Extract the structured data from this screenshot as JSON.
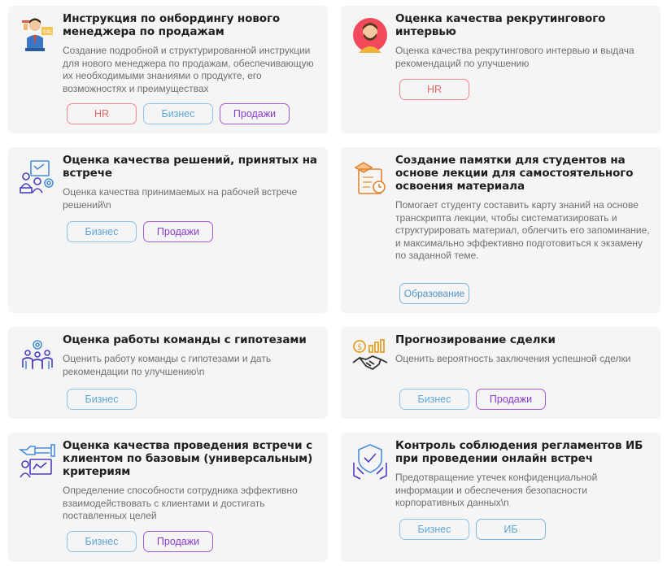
{
  "cards": [
    {
      "icon": "sales-manager-icon",
      "title": "Инструкция по онбордингу нового менеджера по продажам",
      "description": "Создание подробной и структурированной инструкции для нового менеджера по продажам, обеспечивающую их необходимыми знаниями о продукте, его возможностях и преимуществах",
      "tags": [
        "HR",
        "Бизнес",
        "Продажи"
      ]
    },
    {
      "icon": "recruiter-avatar-icon",
      "title": "Оценка качества рекрутингового интервью",
      "description": "Оценка качества рекрутингового интервью и выдача рекомендаций по улучшению",
      "tags": [
        "HR"
      ]
    },
    {
      "icon": "meeting-decisions-icon",
      "title": "Оценка качества решений, принятых на встрече",
      "description": "Оценка качества принимаемых на рабочей встрече решений\\n",
      "tags": [
        "Бизнес",
        "Продажи"
      ]
    },
    {
      "icon": "lecture-notes-icon",
      "title": "Создание памятки для студентов на основе лекции для самостоятельного освоения материала",
      "description": "Помогает студенту составить карту знаний на основе транскрипта лекции, чтобы систематизировать и структурировать материал, облегчить его запоминание, и максимально эффективно подготовиться к экзамену по заданной теме.",
      "tags": [
        "Образование"
      ]
    },
    {
      "icon": "team-hypotheses-icon",
      "title": "Оценка работы команды с гипотезами",
      "description": "Оценить работу команды с гипотезами и дать рекомендации по улучшению\\n",
      "tags": [
        "Бизнес"
      ]
    },
    {
      "icon": "deal-forecast-icon",
      "title": "Прогнозирование сделки",
      "description": "Оценить вероятность заключения успешной сделки",
      "tags": [
        "Бизнес",
        "Продажи"
      ]
    },
    {
      "icon": "client-meeting-icon",
      "title": "Оценка качества проведения встречи с клиентом по базовым (универсальным) критериям",
      "description": "Определение способности сотрудника эффективно взаимодействовать с клиентами и достигать поставленных целей",
      "tags": [
        "Бизнес",
        "Продажи"
      ]
    },
    {
      "icon": "security-shield-icon",
      "title": "Контроль соблюдения регламентов ИБ при проведении онлайн встреч",
      "description": "Предотвращение утечек конфиденциальной информации и обеспечения безопасности корпоративных данных\\n",
      "tags": [
        "Бизнес",
        "ИБ"
      ]
    }
  ],
  "colors": {
    "hr": "#e36666",
    "business": "#5ea6d6",
    "sales": "#8b3ccb",
    "card_bg": "#f5f5f6"
  }
}
